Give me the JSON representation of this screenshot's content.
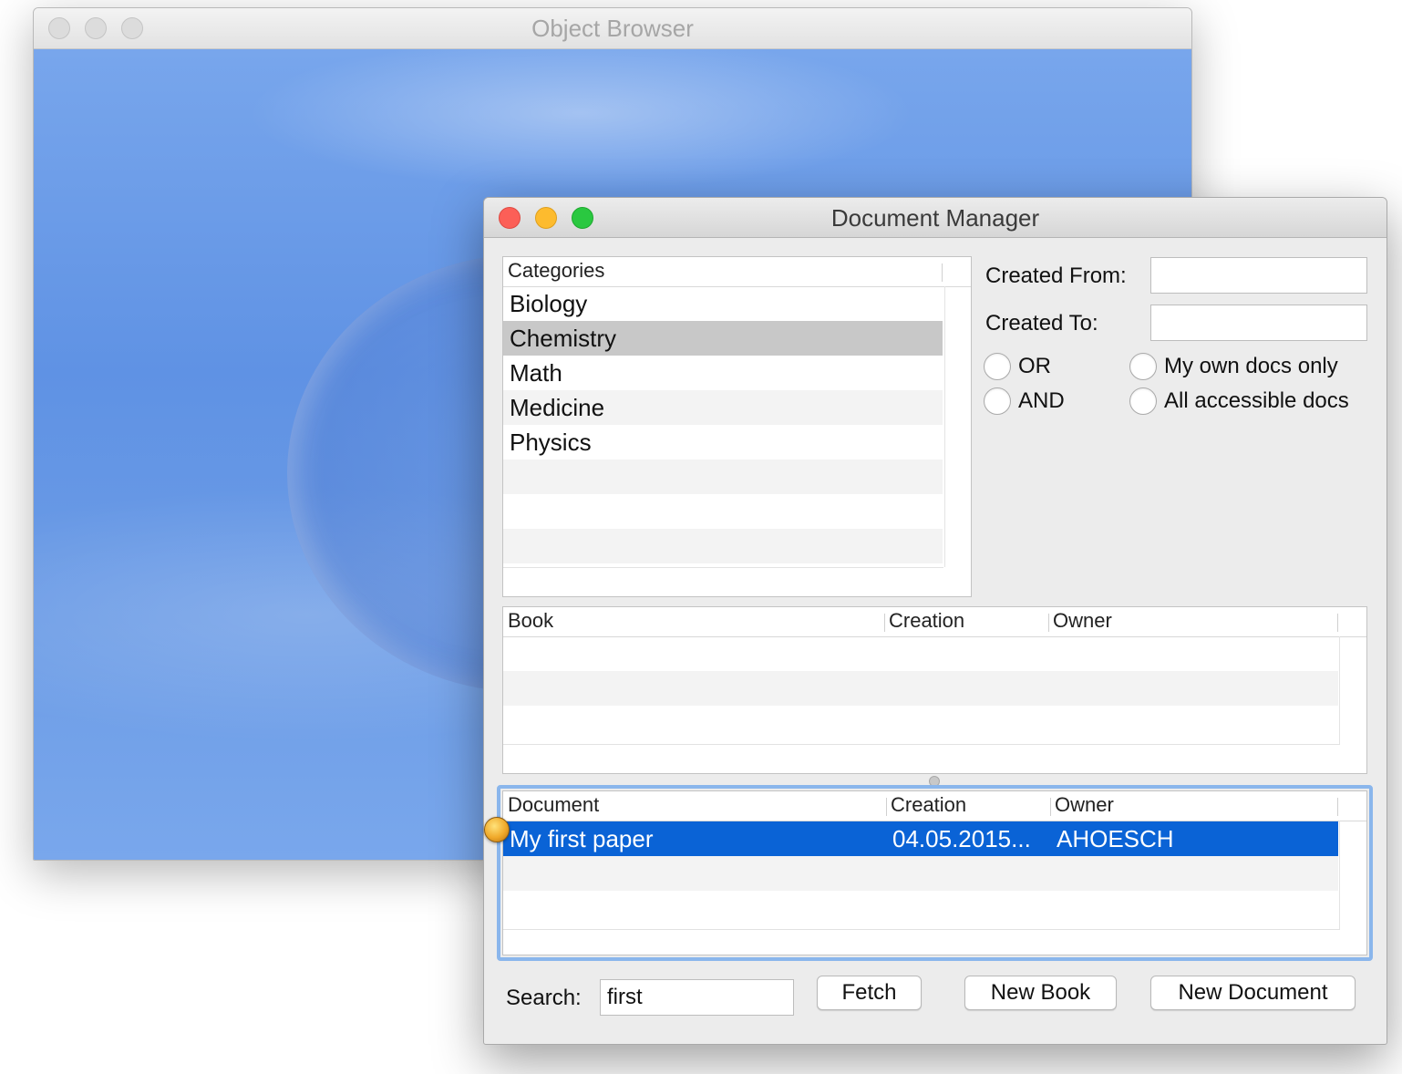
{
  "object_browser": {
    "title": "Object Browser"
  },
  "document_manager": {
    "title": "Document Manager",
    "categories": {
      "header": "Categories",
      "items": [
        "Biology",
        "Chemistry",
        "Math",
        "Medicine",
        "Physics"
      ],
      "selected": "Chemistry"
    },
    "filters": {
      "created_from_label": "Created From:",
      "created_from_value": "",
      "created_to_label": "Created To:",
      "created_to_value": "",
      "or_label": "OR",
      "and_label": "AND",
      "own_docs_label": "My own docs only",
      "all_docs_label": "All accessible docs"
    },
    "books_table": {
      "columns": [
        "Book",
        "Creation",
        "Owner"
      ],
      "rows": []
    },
    "documents_table": {
      "columns": [
        "Document",
        "Creation",
        "Owner"
      ],
      "rows": [
        {
          "document": "My first paper",
          "creation": "04.05.2015...",
          "owner": "AHOESCH"
        }
      ]
    },
    "search": {
      "label": "Search:",
      "value": "first"
    },
    "buttons": {
      "fetch": "Fetch",
      "new_book": "New Book",
      "new_document": "New Document"
    },
    "colors": {
      "selection_blue": "#0a63d6",
      "category_selected_gray": "#c8c8c8",
      "focus_ring": "#8ab6ec"
    }
  }
}
